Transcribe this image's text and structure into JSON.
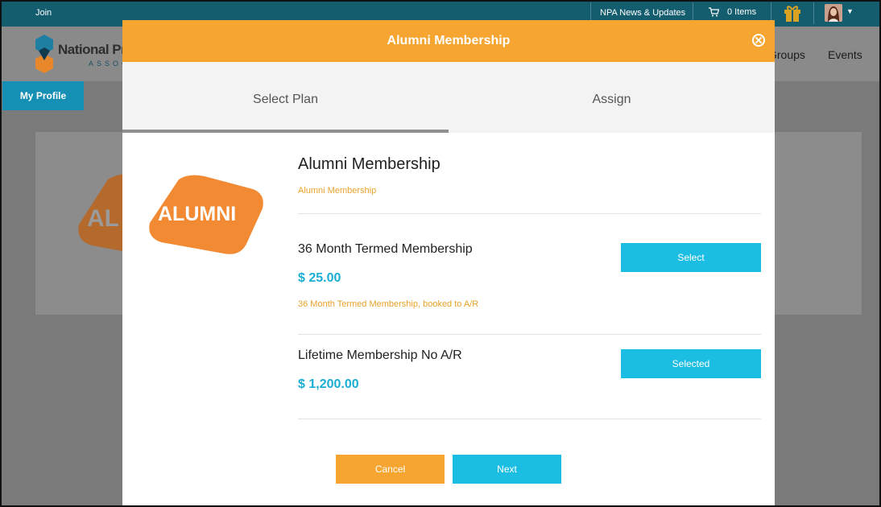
{
  "topbar": {
    "join_label": "Join",
    "news_label": "NPA News & Updates",
    "cart_label": "0 Items"
  },
  "nav": {
    "logo_text": "National Pr",
    "logo_sub": "ASSOCI",
    "menu_groups": "Groups",
    "menu_events": "Events",
    "profile_button": "My Profile",
    "bg_badge_text": "AL"
  },
  "modal": {
    "title": "Alumni Membership",
    "tabs": [
      {
        "label": "Select Plan"
      },
      {
        "label": "Assign"
      }
    ],
    "progress": 0.5,
    "logo_text": "ALUMNI",
    "plan_title": "Alumni Membership",
    "plan_subtitle": "Alumni Membership",
    "options": [
      {
        "name": "36 Month Termed Membership",
        "price": "$ 25.00",
        "description": "36 Month Termed Membership, booked to A/R",
        "button": "Select"
      },
      {
        "name": "Lifetime Membership No A/R",
        "price": "$ 1,200.00",
        "description": "",
        "button": "Selected"
      }
    ],
    "cancel_label": "Cancel",
    "next_label": "Next"
  },
  "colors": {
    "header_orange": "#f5a530",
    "accent_blue": "#1cbde3",
    "topbar_teal": "#145d6f"
  }
}
